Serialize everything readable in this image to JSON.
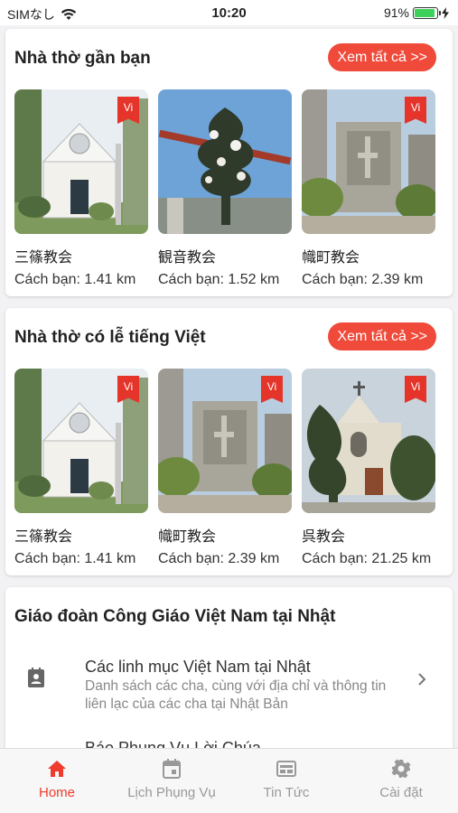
{
  "status": {
    "carrier": "SIMなし",
    "time": "10:20",
    "battery": "91%",
    "battery_level": 0.91
  },
  "nearby": {
    "title": "Nhà thờ gần bạn",
    "see_all": "Xem tất cả >>",
    "items": [
      {
        "name": "三篠教会",
        "distance": "Cách bạn: 1.41 km",
        "badge": "Vi",
        "image": "church-white-photo"
      },
      {
        "name": "観音教会",
        "distance": "Cách bạn: 1.52 km",
        "badge": "Vi",
        "image": "pine-tree-photo"
      },
      {
        "name": "幟町教会",
        "distance": "Cách bạn: 2.39 km",
        "badge": "Vi",
        "image": "cathedral-tower-photo"
      }
    ]
  },
  "vietnamese_mass": {
    "title": "Nhà thờ có lễ tiếng Việt",
    "see_all": "Xem tất cả >>",
    "items": [
      {
        "name": "三篠教会",
        "distance": "Cách bạn: 1.41 km",
        "badge": "Vi",
        "image": "church-white-photo"
      },
      {
        "name": "幟町教会",
        "distance": "Cách bạn: 2.39 km",
        "badge": "Vi",
        "image": "cathedral-tower-photo"
      },
      {
        "name": "呉教会",
        "distance": "Cách bạn: 21.25 km",
        "badge": "Vi",
        "image": "church-cross-photo"
      }
    ]
  },
  "community": {
    "title": "Giáo đoàn Công Giáo Việt Nam tại Nhật",
    "items": [
      {
        "title": "Các linh mục Việt Nam tại Nhật",
        "description": "Danh sách các cha, cùng với địa chỉ và thông tin liên lạc của các cha tại Nhật Bản",
        "icon": "contact-card-icon"
      }
    ],
    "next_item": "Báo Phụng Vụ Lời Chúa"
  },
  "tabs": [
    {
      "label": "Home",
      "icon": "home-icon",
      "active": true
    },
    {
      "label": "Lịch Phụng Vụ",
      "icon": "calendar-icon",
      "active": false
    },
    {
      "label": "Tin Tức",
      "icon": "news-icon",
      "active": false
    },
    {
      "label": "Cài đặt",
      "icon": "gear-icon",
      "active": false
    }
  ],
  "colors": {
    "accent": "#ef4a3a",
    "badge": "#e5342a",
    "battery": "#3bd15a"
  }
}
